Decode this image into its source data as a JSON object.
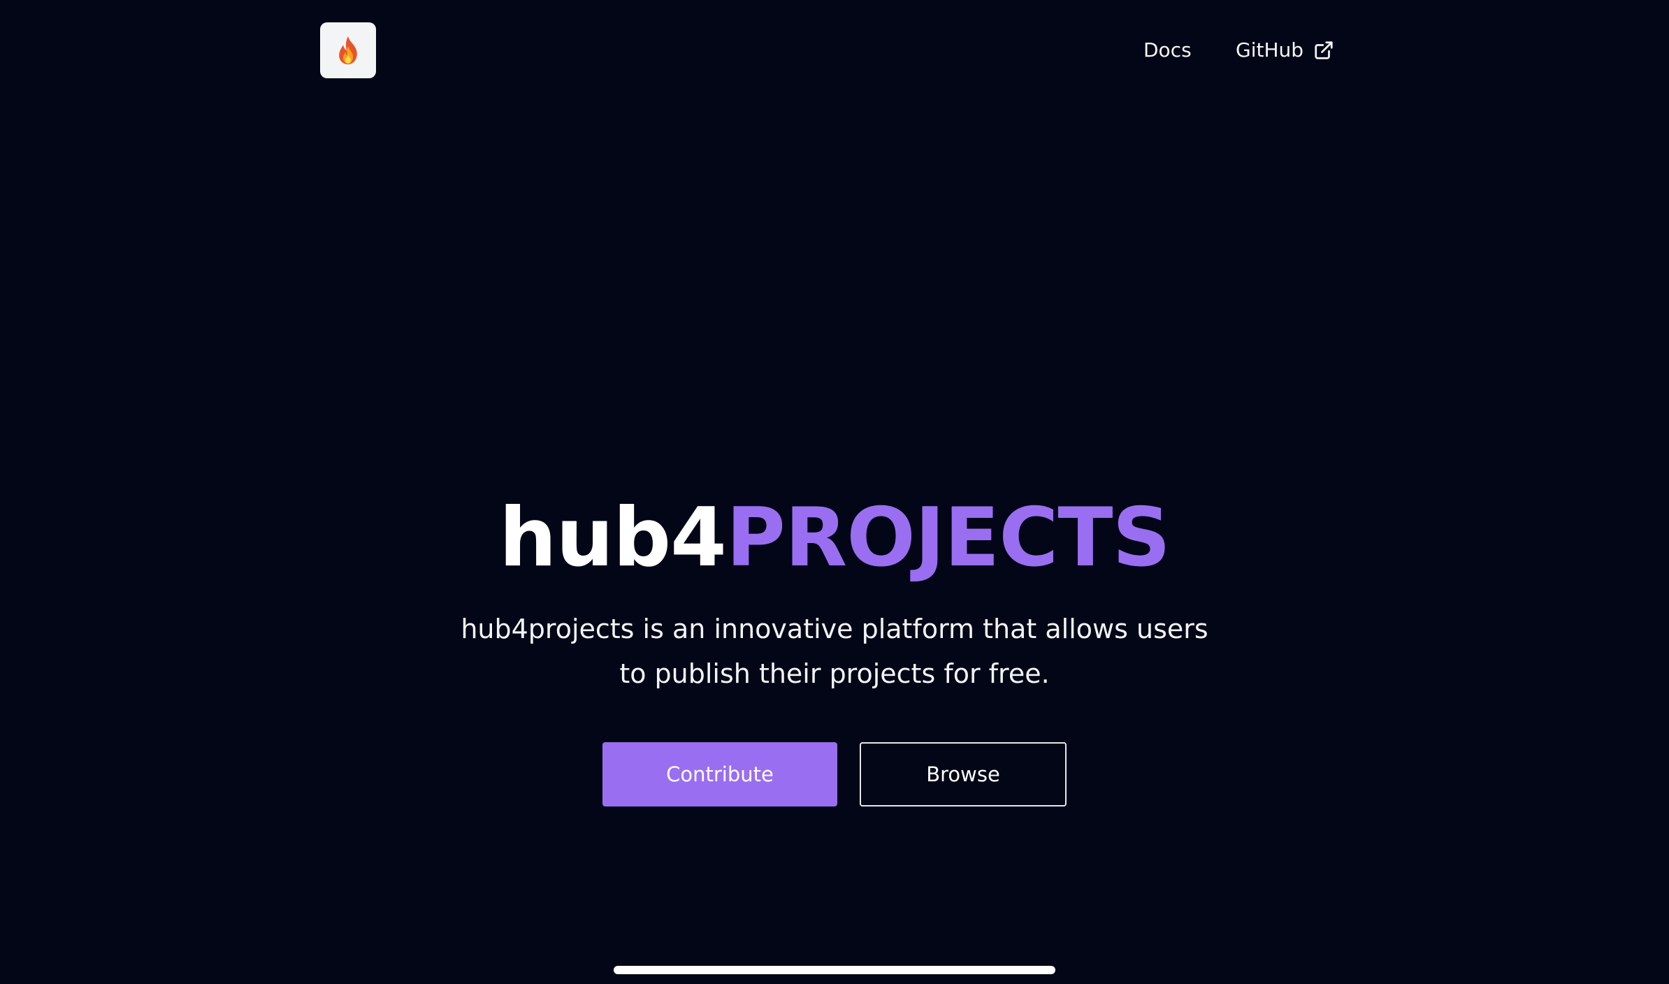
{
  "header": {
    "logo_icon": "fire-icon",
    "nav": {
      "docs_label": "Docs",
      "github_label": "GitHub",
      "github_icon": "external-link-icon"
    }
  },
  "hero": {
    "title_part1": "hub4",
    "title_part2": "PROJECTS",
    "subtitle": "hub4projects is an innovative platform that allows users to publish their projects for free.",
    "buttons": {
      "contribute_label": "Contribute",
      "browse_label": "Browse"
    }
  },
  "colors": {
    "background": "#020616",
    "accent": "#9a6ef0",
    "text": "#ffffff"
  }
}
